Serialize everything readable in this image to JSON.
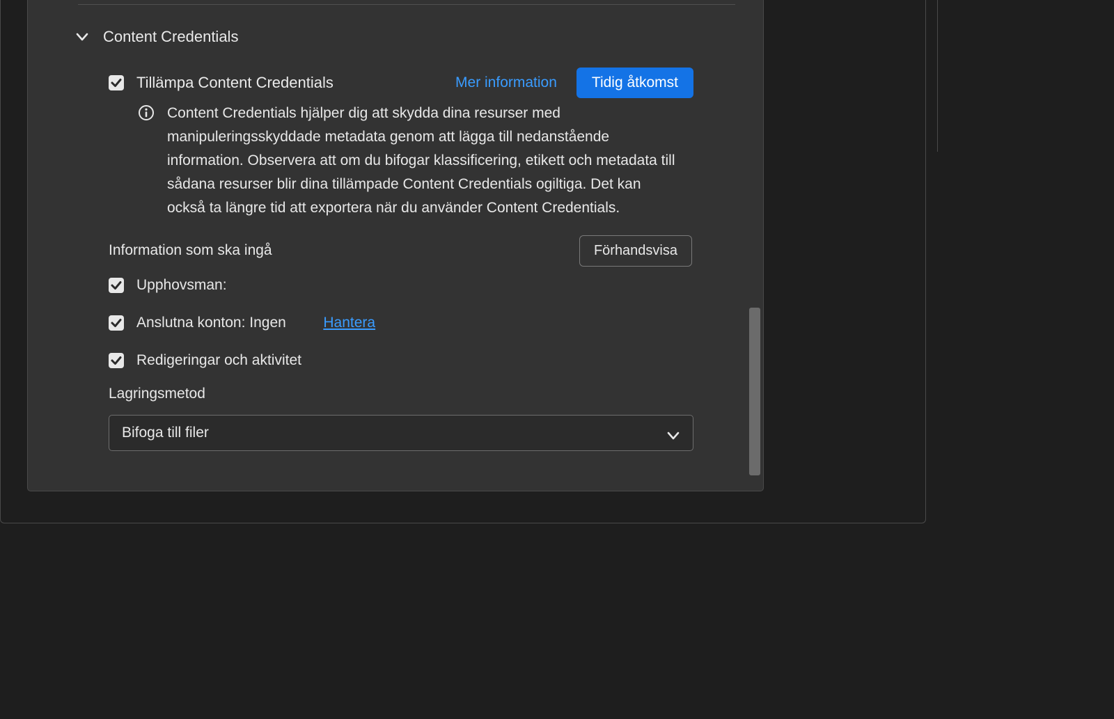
{
  "section": {
    "title": "Content Credentials",
    "apply_label": "Tillämpa Content Credentials",
    "more_info": "Mer information",
    "early_access": "Tidig åtkomst",
    "info_text": "Content Credentials hjälper dig att skydda dina resurser med manipuleringsskyddade metadata genom att lägga till nedanstående information. Observera att om du bifogar klassificering, etikett och metadata till sådana resurser blir dina tillämpade Content Credentials ogiltiga. Det kan också ta längre tid att exportera när du använder Content Credentials.",
    "include_heading": "Information som ska ingå",
    "preview_button": "Förhandsvisa",
    "producer_label": "Upphovsman:",
    "accounts_label": "Anslutna konton: Ingen",
    "manage_link": "Hantera ",
    "edits_label": "Redigeringar och aktivitet",
    "storage_label": "Lagringsmetod",
    "storage_value": "Bifoga till filer"
  }
}
